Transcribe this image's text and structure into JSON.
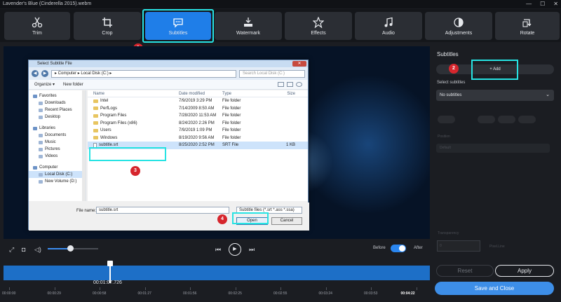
{
  "window": {
    "title": "Lavender's Blue (Cinderella 2015).webm",
    "controls": [
      "—",
      "☐",
      "✕"
    ]
  },
  "toolbar": {
    "tools": [
      {
        "label": "Trim",
        "icon": "scissors-icon"
      },
      {
        "label": "Crop",
        "icon": "crop-icon"
      },
      {
        "label": "Subtitles",
        "icon": "subtitles-icon",
        "active": true
      },
      {
        "label": "Watermark",
        "icon": "watermark-icon"
      },
      {
        "label": "Effects",
        "icon": "effects-icon"
      },
      {
        "label": "Audio",
        "icon": "music-icon"
      },
      {
        "label": "Adjustments",
        "icon": "adjustments-icon"
      },
      {
        "label": "Rotate",
        "icon": "rotate-icon"
      }
    ]
  },
  "steps": [
    "1",
    "2",
    "3",
    "4"
  ],
  "dialog": {
    "title": "Select Subtitle File",
    "close": "✕",
    "path": "▸ Computer ▸ Local Disk (C:) ▸",
    "search_placeholder": "Search Local Disk (C:)",
    "organize": "Organize ▾",
    "new_folder": "New folder",
    "nav": [
      {
        "label": "Favorites",
        "level": 0
      },
      {
        "label": "Downloads",
        "level": 1
      },
      {
        "label": "Recent Places",
        "level": 1
      },
      {
        "label": "Desktop",
        "level": 1
      },
      {
        "label": "",
        "level": -1
      },
      {
        "label": "Libraries",
        "level": 0
      },
      {
        "label": "Documents",
        "level": 1
      },
      {
        "label": "Music",
        "level": 1
      },
      {
        "label": "Pictures",
        "level": 1
      },
      {
        "label": "Videos",
        "level": 1
      },
      {
        "label": "",
        "level": -1
      },
      {
        "label": "Computer",
        "level": 0
      },
      {
        "label": "Local Disk (C:)",
        "level": 1,
        "selected": true
      },
      {
        "label": "New Volume (D:)",
        "level": 1
      }
    ],
    "columns": {
      "name": "Name",
      "date": "Date modified",
      "type": "Type",
      "size": "Size"
    },
    "files": [
      {
        "name": "Intel",
        "date": "7/9/2019 3:29 PM",
        "type": "File folder",
        "size": "",
        "kind": "folder"
      },
      {
        "name": "PerfLogs",
        "date": "7/14/2009 8:50 AM",
        "type": "File folder",
        "size": "",
        "kind": "folder"
      },
      {
        "name": "Program Files",
        "date": "7/28/2020 11:53 AM",
        "type": "File folder",
        "size": "",
        "kind": "folder"
      },
      {
        "name": "Program Files (x86)",
        "date": "8/24/2020 2:26 PM",
        "type": "File folder",
        "size": "",
        "kind": "folder"
      },
      {
        "name": "Users",
        "date": "7/9/2019 1:09 PM",
        "type": "File folder",
        "size": "",
        "kind": "folder"
      },
      {
        "name": "Windows",
        "date": "8/19/2020 9:56 AM",
        "type": "File folder",
        "size": "",
        "kind": "folder"
      },
      {
        "name": "subtitle.srt",
        "date": "8/25/2020 2:52 PM",
        "type": "SRT File",
        "size": "1 KB",
        "kind": "file",
        "selected": true
      }
    ],
    "file_name_label": "File name:",
    "file_name_value": "subtitle.srt",
    "file_type": "Subtitle files (*.srt *.ass *.ssa)",
    "open": "Open",
    "cancel": "Cancel"
  },
  "player": {
    "volume": 0.45,
    "before_label": "Before",
    "after_label": "After",
    "current_time": "00:01:07.726",
    "playhead_fraction": 0.25
  },
  "ruler": [
    "00:00:00",
    "00:00:29",
    "00:00:58",
    "00:01:27",
    "00:01:56",
    "00:02:25",
    "00:02:55",
    "00:03:24",
    "00:03:53",
    "00:04:22"
  ],
  "panel": {
    "title": "Subtitles",
    "add_label": "+ Add",
    "select_label": "Select subtitles",
    "select_value": "No subtitles",
    "position_label": "Position",
    "position_value": "Default",
    "transparency_label": "Transparency",
    "number_value": "0",
    "unit_label": "Pixel.Line",
    "reset": "Reset",
    "apply": "Apply",
    "save": "Save and Close"
  }
}
